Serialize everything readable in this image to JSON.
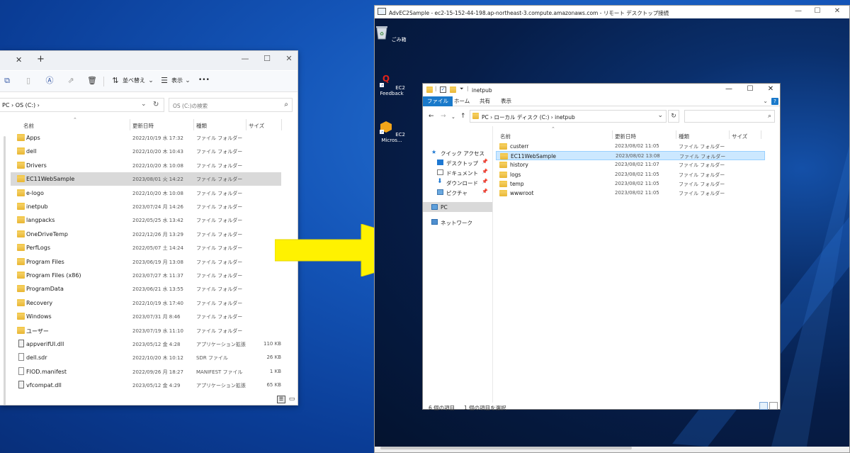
{
  "left_window": {
    "tab_close": "✕",
    "tab_add": "+",
    "controls": {
      "minimize": "—",
      "maximize": "☐",
      "close": "✕"
    },
    "toolbar": {
      "sort_label": "並べ替え",
      "view_label": "表示",
      "more": "•••"
    },
    "address": "PC  ›  OS (C:)  ›",
    "search_placeholder": "OS (C:)の検索",
    "columns": {
      "name": "名前",
      "date": "更新日時",
      "type": "種類",
      "size": "サイズ"
    },
    "rows": [
      {
        "name": "Apps",
        "date": "2022/10/19 水 17:32",
        "type": "ファイル フォルダー",
        "size": "",
        "kind": "folder"
      },
      {
        "name": "dell",
        "date": "2022/10/20 木 10:43",
        "type": "ファイル フォルダー",
        "size": "",
        "kind": "folder"
      },
      {
        "name": "Drivers",
        "date": "2022/10/20 木 10:08",
        "type": "ファイル フォルダー",
        "size": "",
        "kind": "folder"
      },
      {
        "name": "EC11WebSample",
        "date": "2023/08/01 火 14:22",
        "type": "ファイル フォルダー",
        "size": "",
        "kind": "folder"
      },
      {
        "name": "e-logo",
        "date": "2022/10/20 木 10:08",
        "type": "ファイル フォルダー",
        "size": "",
        "kind": "folder"
      },
      {
        "name": "inetpub",
        "date": "2023/07/24 月 14:26",
        "type": "ファイル フォルダー",
        "size": "",
        "kind": "folder"
      },
      {
        "name": "langpacks",
        "date": "2022/05/25 水 13:42",
        "type": "ファイル フォルダー",
        "size": "",
        "kind": "folder"
      },
      {
        "name": "OneDriveTemp",
        "date": "2022/12/26 月 13:29",
        "type": "ファイル フォルダー",
        "size": "",
        "kind": "folder"
      },
      {
        "name": "PerfLogs",
        "date": "2022/05/07 土 14:24",
        "type": "ファイル フォルダー",
        "size": "",
        "kind": "folder"
      },
      {
        "name": "Program Files",
        "date": "2023/06/19 月 13:08",
        "type": "ファイル フォルダー",
        "size": "",
        "kind": "folder"
      },
      {
        "name": "Program Files (x86)",
        "date": "2023/07/27 木 11:37",
        "type": "ファイル フォルダー",
        "size": "",
        "kind": "folder"
      },
      {
        "name": "ProgramData",
        "date": "2023/06/21 水 13:55",
        "type": "ファイル フォルダー",
        "size": "",
        "kind": "folder"
      },
      {
        "name": "Recovery",
        "date": "2022/10/19 水 17:40",
        "type": "ファイル フォルダー",
        "size": "",
        "kind": "folder"
      },
      {
        "name": "Windows",
        "date": "2023/07/31 月 8:46",
        "type": "ファイル フォルダー",
        "size": "",
        "kind": "folder"
      },
      {
        "name": "ユーザー",
        "date": "2023/07/19 水 11:10",
        "type": "ファイル フォルダー",
        "size": "",
        "kind": "folder"
      },
      {
        "name": "appverifUI.dll",
        "date": "2023/05/12 金 4:28",
        "type": "アプリケーション拡張",
        "size": "110 KB",
        "kind": "gear"
      },
      {
        "name": "dell.sdr",
        "date": "2022/10/20 木 10:12",
        "type": "SDR ファイル",
        "size": "26 KB",
        "kind": "file"
      },
      {
        "name": "FIOD.manifest",
        "date": "2022/09/26 月 18:27",
        "type": "MANIFEST ファイル",
        "size": "1 KB",
        "kind": "file"
      },
      {
        "name": "vfcompat.dll",
        "date": "2023/05/12 金 4:29",
        "type": "アプリケーション拡張",
        "size": "65 KB",
        "kind": "gear"
      }
    ],
    "selected_index": 3
  },
  "rdp": {
    "title": "AdvEC2Sample - ec2-15-152-44-198.ap-northeast-3.compute.amazonaws.com - リモート デスクトップ接続",
    "controls": {
      "minimize": "—",
      "maximize": "☐",
      "close": "✕"
    },
    "desktop_icons": [
      {
        "label": "ごみ箱",
        "icon": "recycle-bin-icon"
      },
      {
        "label": "EC2 Feedback",
        "icon": "feedback-icon"
      },
      {
        "label": "EC2 Micros...",
        "icon": "ec2-microsoft-icon"
      }
    ],
    "explorer": {
      "title": "inetpub",
      "controls": {
        "minimize": "—",
        "maximize": "☐",
        "close": "✕"
      },
      "ribbon_tabs": [
        "ファイル",
        "ホーム",
        "共有",
        "表示"
      ],
      "help": "?",
      "address": "PC  ›  ローカル ディスク (C:)  ›  inetpub",
      "nav": {
        "quick_access": "クイック アクセス",
        "desktop": "デスクトップ",
        "documents": "ドキュメント",
        "downloads": "ダウンロード",
        "pictures": "ピクチャ",
        "pc": "PC",
        "network": "ネットワーク"
      },
      "columns": {
        "name": "名前",
        "date": "更新日時",
        "type": "種類",
        "size": "サイズ"
      },
      "rows": [
        {
          "name": "custerr",
          "date": "2023/08/02 11:05",
          "type": "ファイル フォルダー"
        },
        {
          "name": "EC11WebSample",
          "date": "2023/08/02 13:08",
          "type": "ファイル フォルダー"
        },
        {
          "name": "history",
          "date": "2023/08/02 11:07",
          "type": "ファイル フォルダー"
        },
        {
          "name": "logs",
          "date": "2023/08/02 11:05",
          "type": "ファイル フォルダー"
        },
        {
          "name": "temp",
          "date": "2023/08/02 11:05",
          "type": "ファイル フォルダー"
        },
        {
          "name": "wwwroot",
          "date": "2023/08/02 11:05",
          "type": "ファイル フォルダー"
        }
      ],
      "selected_index": 1,
      "status": {
        "count": "6 個の項目",
        "selected": "1 個の項目を選択"
      }
    }
  },
  "colors": {
    "arrow": "#fff200",
    "selection_blue": "#cce8ff",
    "ribbon_blue": "#1979ca"
  }
}
